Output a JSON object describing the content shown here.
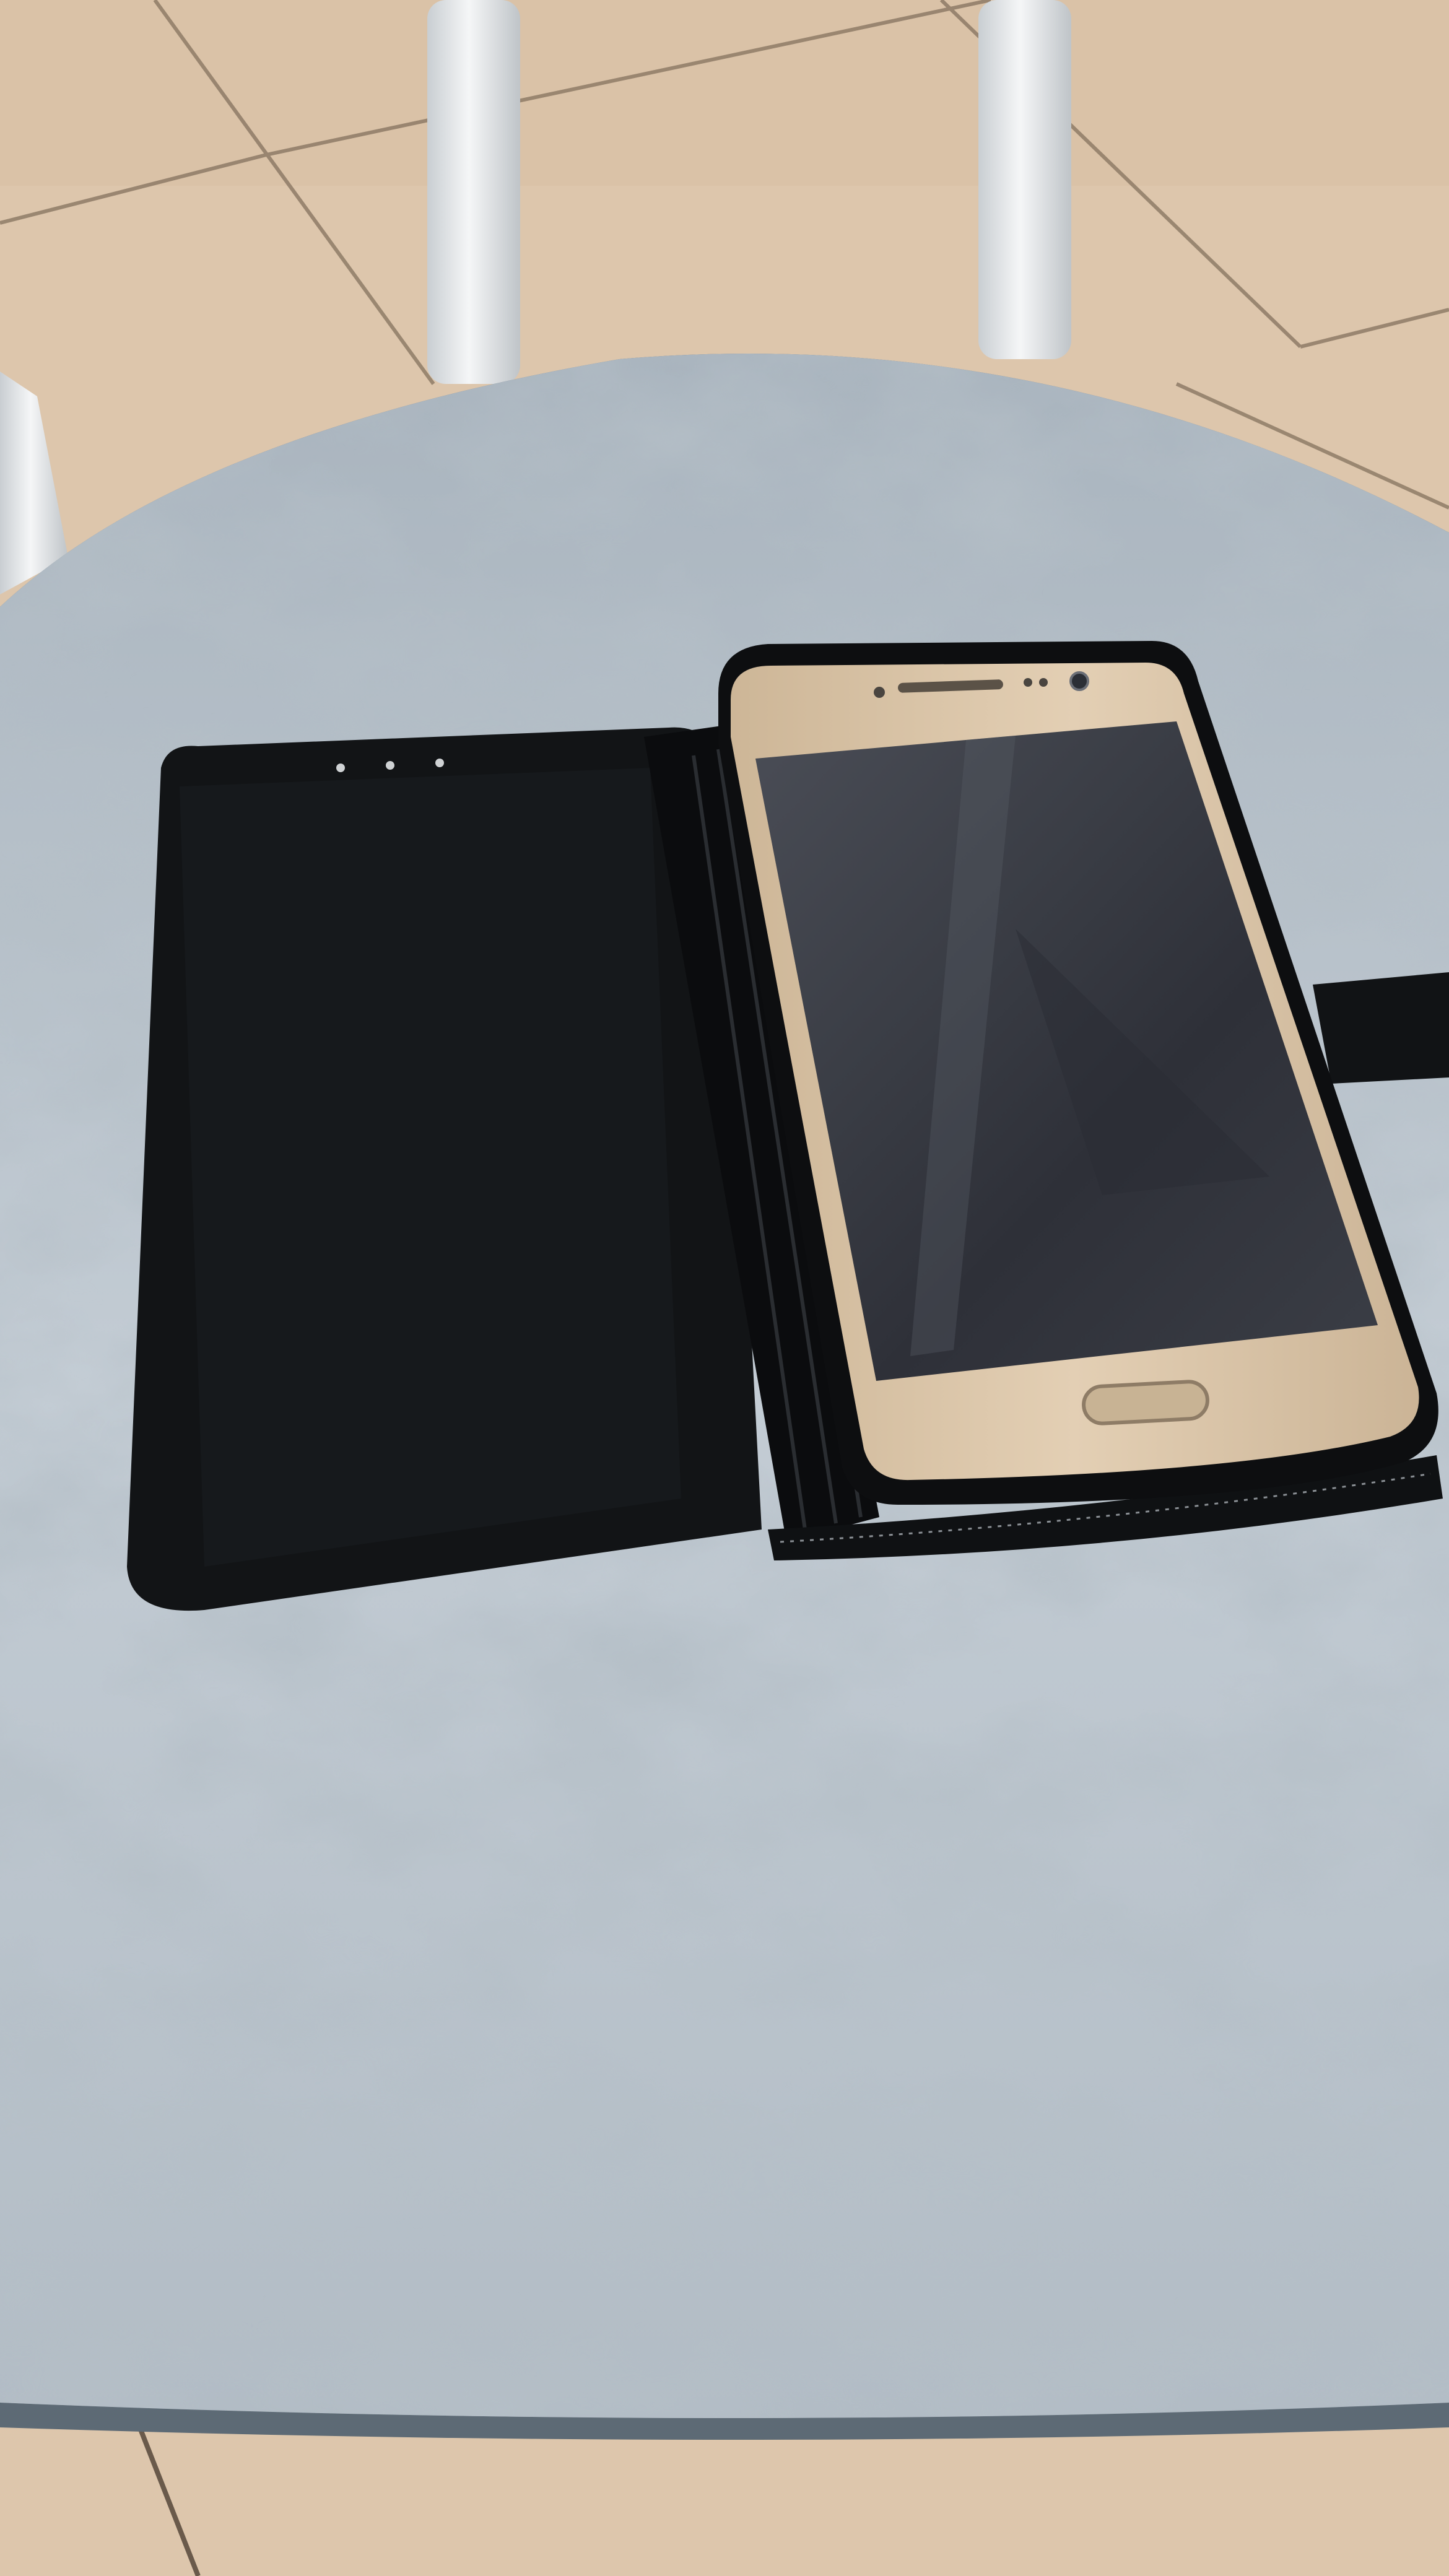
{
  "scene": {
    "colors": {
      "floor_tile": "#ddc6ac",
      "floor_grout": "#8a7763",
      "chair_legs": "#eceff1",
      "stool_top_light": "#bcc6cf",
      "stool_top_dark": "#74828e",
      "stool_edge": "#5d6a75",
      "wallet_case": "#121416",
      "phone_body": "#d9c3a6",
      "phone_screen": "#3c3f47",
      "home_button": "#c8b394"
    },
    "objects": [
      "floor-tiles",
      "chair-legs",
      "marbled-stool-seat",
      "wallet-case-cover",
      "wallet-case-spine",
      "phone-case",
      "phone",
      "phone-screen",
      "home-button",
      "earpiece",
      "front-camera",
      "case-clasp-strap"
    ]
  }
}
